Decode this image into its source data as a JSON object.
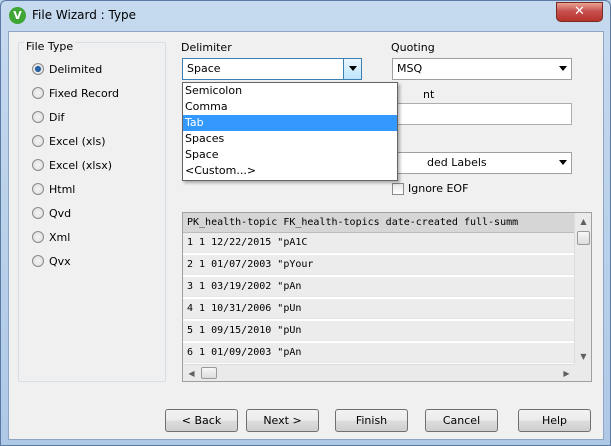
{
  "window": {
    "title": "File Wizard : Type",
    "app_icon_letter": "V",
    "close_glyph": "✕"
  },
  "file_type": {
    "title": "File Type",
    "options": [
      {
        "label": "Delimited",
        "checked": true
      },
      {
        "label": "Fixed Record",
        "checked": false
      },
      {
        "label": "Dif",
        "checked": false
      },
      {
        "label": "Excel (xls)",
        "checked": false
      },
      {
        "label": "Excel (xlsx)",
        "checked": false
      },
      {
        "label": "Html",
        "checked": false
      },
      {
        "label": "Qvd",
        "checked": false
      },
      {
        "label": "Xml",
        "checked": false
      },
      {
        "label": "Qvx",
        "checked": false
      }
    ]
  },
  "delimiter": {
    "label": "Delimiter",
    "value": "Space",
    "options": [
      "Semicolon",
      "Comma",
      "Tab",
      "Spaces",
      "Space",
      "<Custom...>"
    ],
    "highlighted": "Tab"
  },
  "quoting": {
    "label": "Quoting",
    "value": "MSQ"
  },
  "comment": {
    "label_visible": "nt"
  },
  "labels": {
    "value_visible": "ded Labels"
  },
  "ignore_eof": {
    "label": "Ignore EOF",
    "checked": false
  },
  "preview": {
    "header": "PK_health-topic FK_health-topics date-created full-summ",
    "rows": [
      "1 1 12/22/2015 \"pA1C",
      "2 1 01/07/2003 \"pYour",
      "3 1 03/19/2002 \"pAn",
      "4 1 10/31/2006 \"pUn",
      "5 1 09/15/2010 \"pUn",
      "6 1 01/09/2003 \"pAn"
    ]
  },
  "buttons": {
    "back": "< Back",
    "next": "Next >",
    "finish": "Finish",
    "cancel": "Cancel",
    "help": "Help"
  },
  "scroll_glyphs": {
    "up": "▲",
    "down": "▼",
    "left": "◀",
    "right": "▶"
  }
}
